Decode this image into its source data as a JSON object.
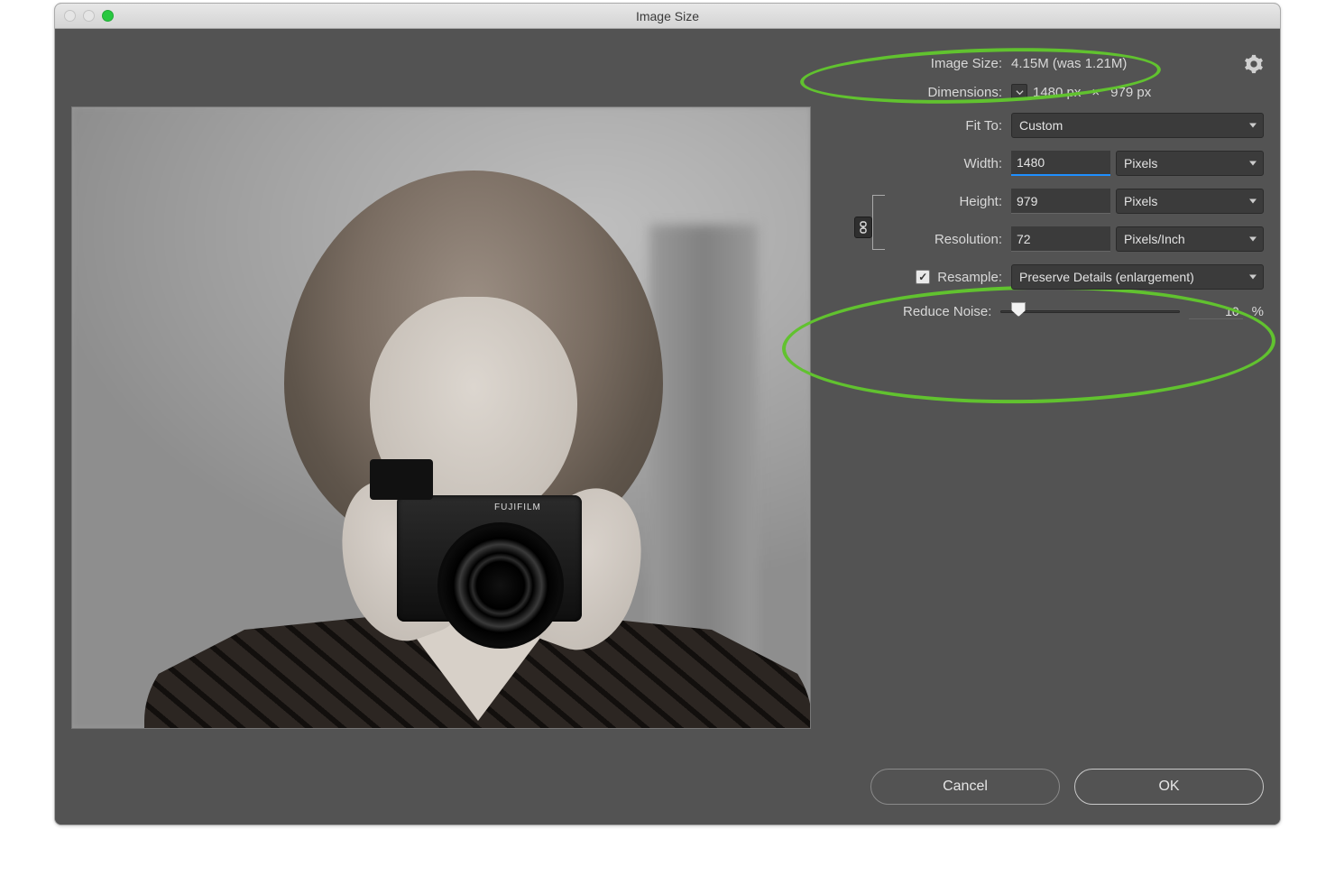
{
  "window": {
    "title": "Image Size"
  },
  "info": {
    "image_size_label": "Image Size:",
    "image_size_value": "4.15M (was 1.21M)",
    "dimensions_label": "Dimensions:",
    "dim_w": "1480 px",
    "dim_h": "979 px"
  },
  "fit": {
    "label": "Fit To:",
    "value": "Custom"
  },
  "width": {
    "label": "Width:",
    "value": "1480",
    "unit": "Pixels"
  },
  "height": {
    "label": "Height:",
    "value": "979",
    "unit": "Pixels"
  },
  "resolution": {
    "label": "Resolution:",
    "value": "72",
    "unit": "Pixels/Inch"
  },
  "resample": {
    "label": "Resample:",
    "checked": true,
    "method": "Preserve Details (enlargement)"
  },
  "noise": {
    "label": "Reduce Noise:",
    "value": "10",
    "percent_pos": 10
  },
  "camera_brand": "FUJIFILM",
  "buttons": {
    "cancel": "Cancel",
    "ok": "OK"
  }
}
